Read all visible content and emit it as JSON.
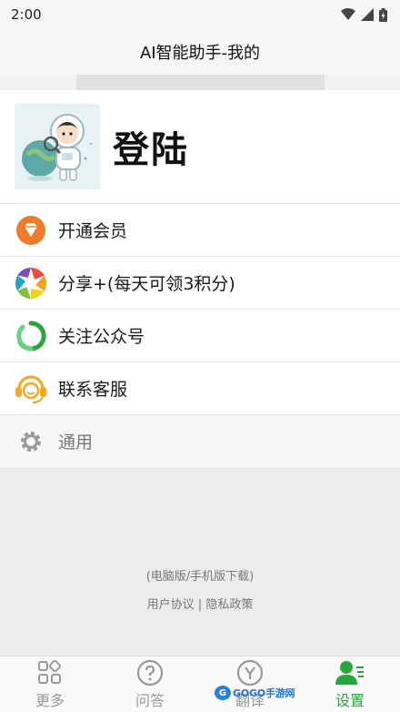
{
  "status_bar": {
    "time": "2:00"
  },
  "header": {
    "title": "AI智能助手-我的"
  },
  "profile": {
    "login_label": "登陆"
  },
  "menu": [
    {
      "icon": "diamond-icon",
      "label": "开通会员"
    },
    {
      "icon": "aperture-icon",
      "label": "分享+(每天可领3积分)"
    },
    {
      "icon": "follow-loop-icon",
      "label": "关注公众号"
    },
    {
      "icon": "headset-icon",
      "label": "联系客服"
    },
    {
      "icon": "gear-icon",
      "label": "通用"
    }
  ],
  "footer": {
    "download": "(电脑版/手机版下载)",
    "user_agreement": "用户协议",
    "separator": "|",
    "privacy_policy": "隐私政策"
  },
  "tabs": [
    {
      "icon": "grid-icon",
      "label": "更多",
      "active": false
    },
    {
      "icon": "question-icon",
      "label": "问答",
      "active": false
    },
    {
      "icon": "translate-icon",
      "label": "翻译",
      "active": false
    },
    {
      "icon": "user-settings-icon",
      "label": "设置",
      "active": true
    }
  ],
  "watermark": {
    "text": "GOGO手游网"
  },
  "colors": {
    "active_tab": "#2aa63f",
    "background": "#ececec",
    "orange": "#f07a2c"
  }
}
